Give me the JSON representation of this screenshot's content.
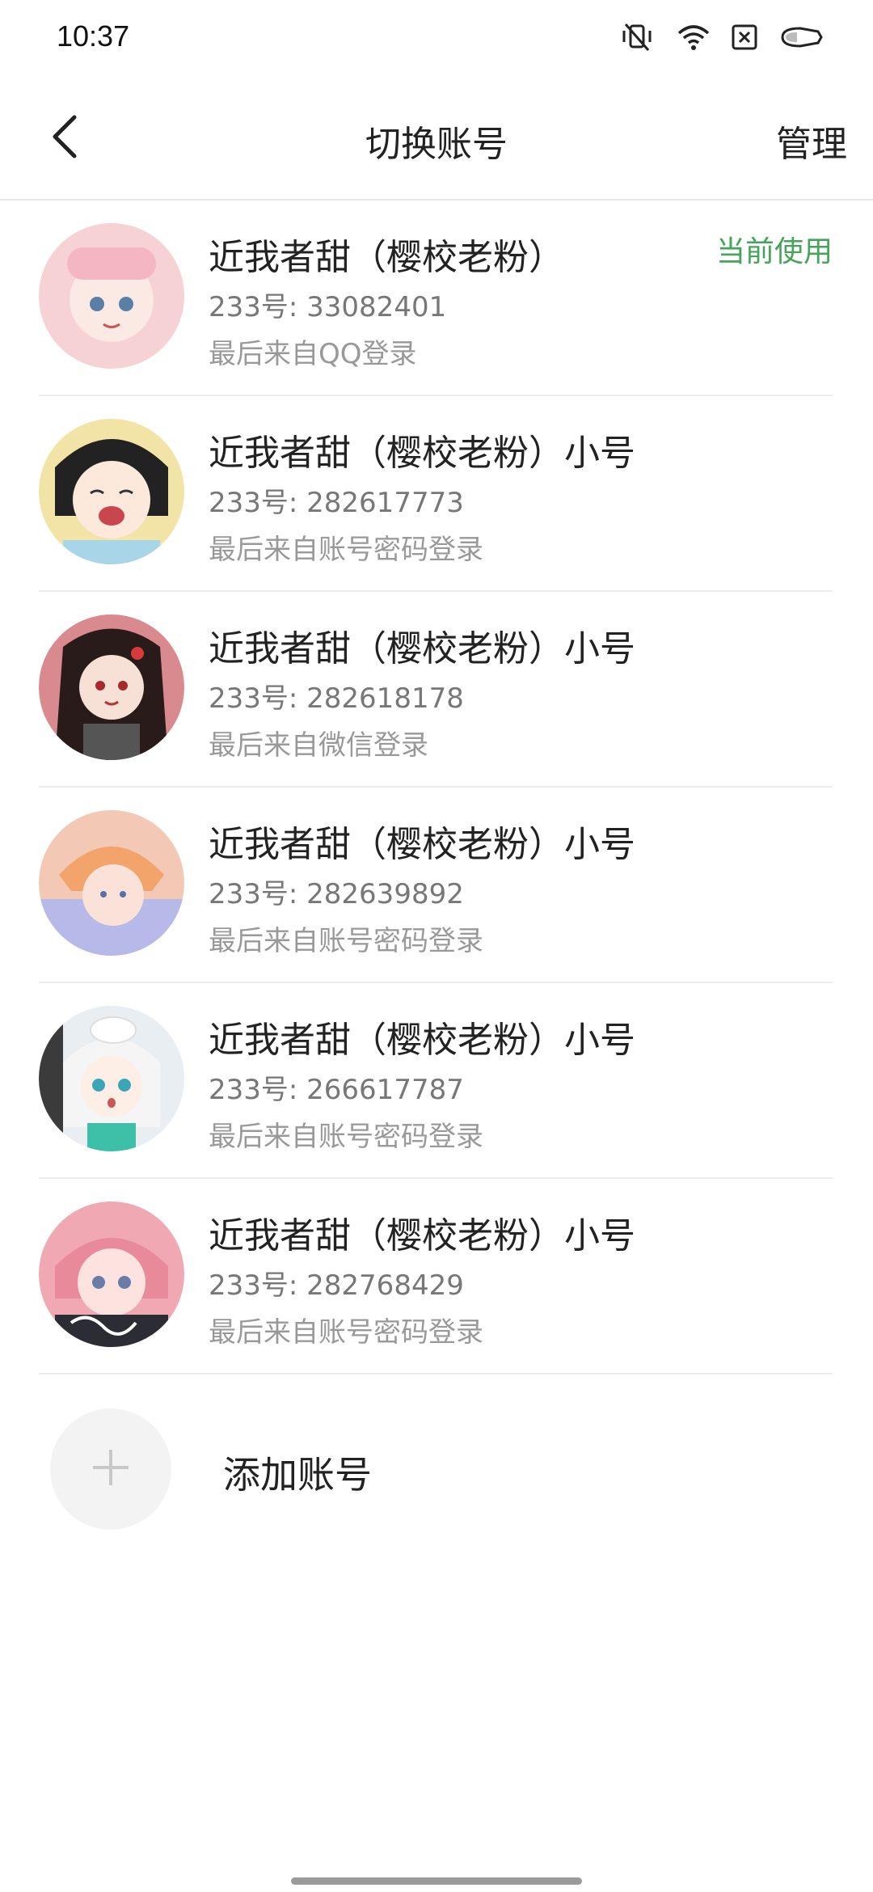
{
  "status_bar": {
    "time": "10:37",
    "icons": [
      "mute-vibrate-icon",
      "wifi-icon",
      "sim-off-icon",
      "battery-icon"
    ]
  },
  "header": {
    "title": "切换账号",
    "back_icon": "chevron-left-icon",
    "manage_label": "管理"
  },
  "accounts": [
    {
      "name": "近我者甜（樱校老粉）",
      "id_text": "233号: 33082401",
      "login_text": "最后来自QQ登录",
      "badge": "当前使用",
      "avatar_color": "#f6d2d4"
    },
    {
      "name": "近我者甜（樱校老粉）小号",
      "id_text": "233号: 282617773",
      "login_text": "最后来自账号密码登录",
      "avatar_color": "#f2e3a6"
    },
    {
      "name": "近我者甜（樱校老粉）小号",
      "id_text": "233号: 282618178",
      "login_text": "最后来自微信登录",
      "avatar_color": "#d98a8f"
    },
    {
      "name": "近我者甜（樱校老粉）小号",
      "id_text": "233号: 282639892",
      "login_text": "最后来自账号密码登录",
      "avatar_color": "#f3c9b5"
    },
    {
      "name": "近我者甜（樱校老粉）小号",
      "id_text": "233号: 266617787",
      "login_text": "最后来自账号密码登录",
      "avatar_color": "#e8eef2"
    },
    {
      "name": "近我者甜（樱校老粉）小号",
      "id_text": "233号: 282768429",
      "login_text": "最后来自账号密码登录",
      "avatar_color": "#f0a9b3"
    }
  ],
  "add_account": {
    "icon": "plus-icon",
    "label": "添加账号"
  },
  "colors": {
    "accent_green": "#45a45a",
    "divider": "#ececec"
  }
}
